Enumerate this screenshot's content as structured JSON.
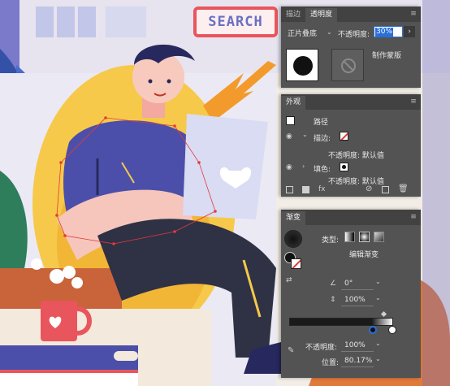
{
  "illustration": {
    "search_label": "SEARCH"
  },
  "transparency_panel": {
    "tabs": [
      "描边",
      "透明度"
    ],
    "active_tab": "透明度",
    "blend_mode": "正片叠底",
    "opacity_label": "不透明度:",
    "opacity_value": "30%",
    "make_mask_label": "制作蒙版"
  },
  "appearance_panel": {
    "title": "外观",
    "object_label": "路径",
    "stroke_label": "描边:",
    "stroke_opacity": "不透明度: 默认值",
    "fill_label": "填色:",
    "fill_opacity": "不透明度: 默认值"
  },
  "gradient_panel": {
    "title": "渐变",
    "type_label": "类型:",
    "edit_gradient_label": "编辑渐变",
    "angle_value": "0°",
    "aspect_value": "100%",
    "stop_opacity_label": "不透明度:",
    "stop_opacity_value": "100%",
    "location_label": "位置:",
    "location_value": "80.17%"
  },
  "colors": {
    "panel_bg": "#535353",
    "tab_bar": "#424242",
    "accent_blue": "#2a6fd6",
    "warning_red": "#e03c31"
  }
}
